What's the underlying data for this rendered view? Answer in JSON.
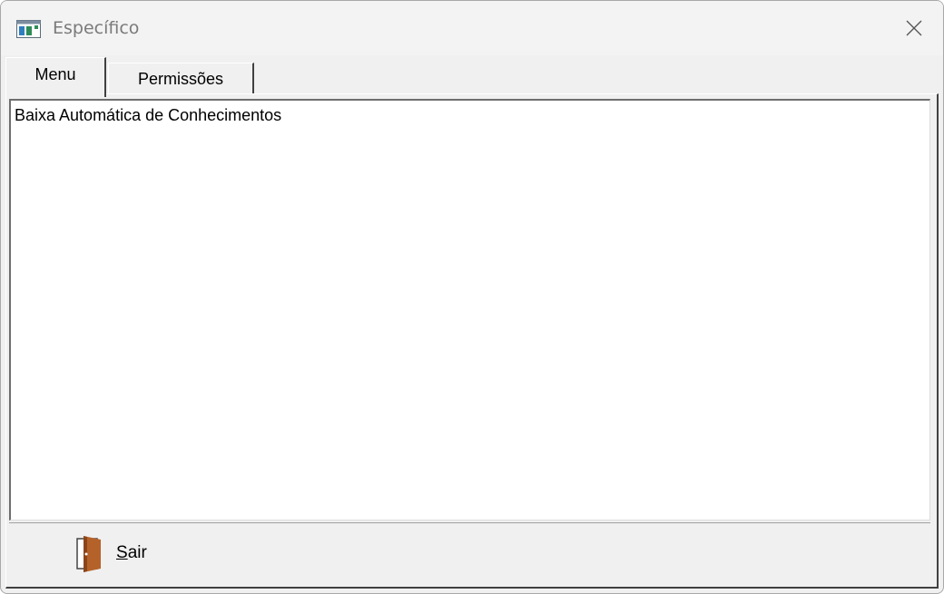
{
  "window": {
    "title": "Específico",
    "icons": {
      "app": "window-app-icon",
      "close": "close-icon"
    }
  },
  "tabs": [
    {
      "label": "Menu",
      "active": true
    },
    {
      "label": "Permissões",
      "active": false
    }
  ],
  "list": {
    "items": [
      "Baixa Automática de Conhecimentos"
    ]
  },
  "footer": {
    "exit_button": {
      "mnemonic": "S",
      "rest": "air",
      "icon": "door-exit-icon"
    }
  },
  "colors": {
    "door": "#b5622a",
    "window_bg": "#f0f0f0",
    "title_text": "#7a7a7a"
  }
}
